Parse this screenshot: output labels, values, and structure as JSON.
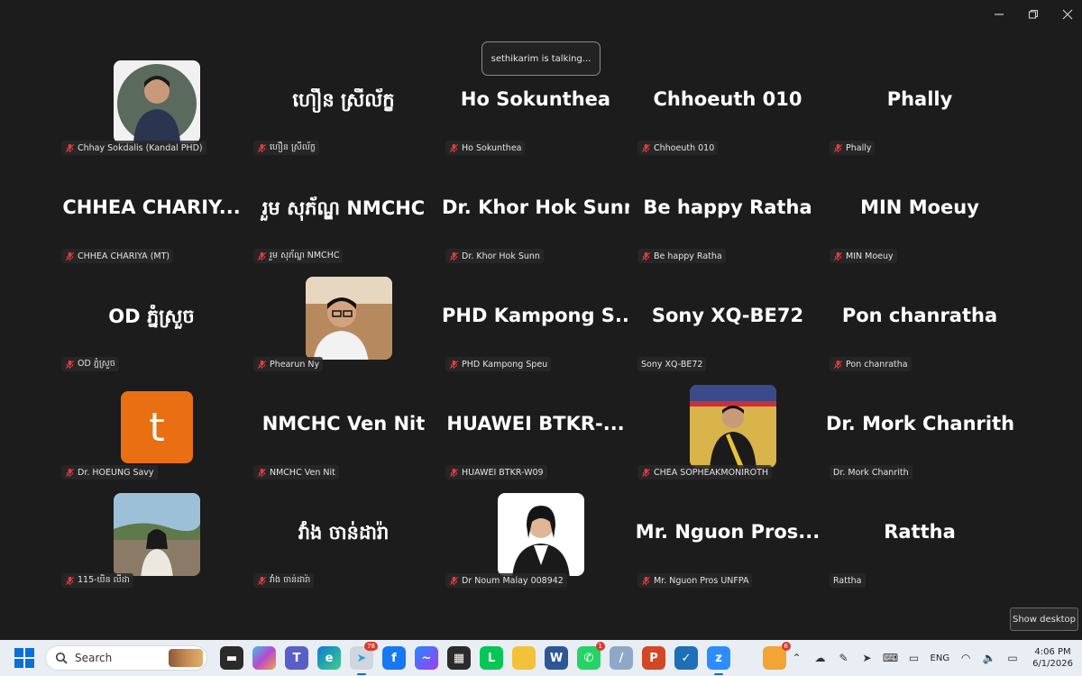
{
  "meeting": {
    "talking_indicator": "sethikarim is talking...",
    "show_desktop_label": "Show desktop"
  },
  "participants": [
    {
      "display": "",
      "label": "Chhay Sokdalis (Kandal PHD)",
      "muted": true,
      "video": "photo-woman-office"
    },
    {
      "display": "ហឿន ស្រីល័ក្ខ",
      "label": "ហឿន ស្រីល័ក្ខ",
      "muted": true
    },
    {
      "display": "Ho Sokunthea",
      "label": "Ho Sokunthea",
      "muted": true
    },
    {
      "display": "Chhoeuth 010",
      "label": "Chhoeuth 010",
      "muted": true
    },
    {
      "display": "Phally",
      "label": "Phally",
      "muted": true
    },
    {
      "display": "CHHEA CHARIY...",
      "label": "CHHEA CHARIYA (MT)",
      "muted": true
    },
    {
      "display": "រួម សុភ័ណ្ឌ NMCHC",
      "label": "រួម សុភ័ណ្ឌ NMCHC",
      "muted": true
    },
    {
      "display": "Dr. Khor Hok Sunn",
      "label": "Dr. Khor Hok Sunn",
      "muted": true
    },
    {
      "display": "Be happy Ratha",
      "label": "Be happy Ratha",
      "muted": true
    },
    {
      "display": "MIN Moeuy",
      "label": "MIN Moeuy",
      "muted": true
    },
    {
      "display": "OD ភ្នំស្រួច",
      "label": "OD ភ្នំស្រួច",
      "muted": true
    },
    {
      "display": "",
      "label": "Phearun Ny",
      "muted": true,
      "video": "photo-man-glasses"
    },
    {
      "display": "PHD Kampong S...",
      "label": "PHD Kampong Speu",
      "muted": true
    },
    {
      "display": "Sony XQ-BE72",
      "label": "Sony XQ-BE72",
      "muted": false
    },
    {
      "display": "Pon chanratha",
      "label": "Pon chanratha",
      "muted": true
    },
    {
      "display": "t",
      "label": "Dr. HOEUNG Savy",
      "muted": true,
      "video": "letter-avatar"
    },
    {
      "display": "NMCHC Ven Nit",
      "label": "NMCHC Ven Nit",
      "muted": true
    },
    {
      "display": "HUAWEI BTKR-...",
      "label": "HUAWEI BTKR-W09",
      "muted": true
    },
    {
      "display": "",
      "label": "CHEA SOPHEAKMONIROTH",
      "muted": true,
      "video": "photo-man-suit"
    },
    {
      "display": "Dr. Mork Chanrith",
      "label": "Dr. Mork Chanrith",
      "muted": false
    },
    {
      "display": "",
      "label": "115-ឃិន លីដា",
      "muted": true,
      "video": "photo-woman-wall"
    },
    {
      "display": "វាំង ចាន់ដារ៉ា",
      "label": "វាំង ចាន់ដារ៉ា",
      "muted": true
    },
    {
      "display": "",
      "label": "Dr Noum Malay 008942",
      "muted": true,
      "video": "photo-woman-portrait"
    },
    {
      "display": "Mr. Nguon Pros...",
      "label": "Mr. Nguon Pros UNFPA",
      "muted": true
    },
    {
      "display": "Rattha",
      "label": "Rattha",
      "muted": false
    }
  ],
  "taskbar": {
    "search_placeholder": "Search",
    "apps": [
      {
        "icon": "file-explorer-icon",
        "badge": ""
      },
      {
        "icon": "copilot-icon",
        "badge": ""
      },
      {
        "icon": "teams-icon",
        "badge": ""
      },
      {
        "icon": "edge-icon",
        "badge": ""
      },
      {
        "icon": "telegram-icon",
        "badge": "78"
      },
      {
        "icon": "facebook-icon",
        "badge": ""
      },
      {
        "icon": "messenger-icon",
        "badge": ""
      },
      {
        "icon": "store-icon",
        "badge": ""
      },
      {
        "icon": "line-icon",
        "badge": ""
      },
      {
        "icon": "folder-icon",
        "badge": ""
      },
      {
        "icon": "word-icon",
        "badge": ""
      },
      {
        "icon": "whatsapp-icon",
        "badge": "1"
      },
      {
        "icon": "tool-icon",
        "badge": ""
      },
      {
        "icon": "powerpoint-icon",
        "badge": ""
      },
      {
        "icon": "app-icon",
        "badge": ""
      },
      {
        "icon": "zoom-icon",
        "badge": ""
      }
    ],
    "weather_badge": "6",
    "language": "ENG",
    "time": "4:06 PM",
    "date": "6/1/2026"
  }
}
